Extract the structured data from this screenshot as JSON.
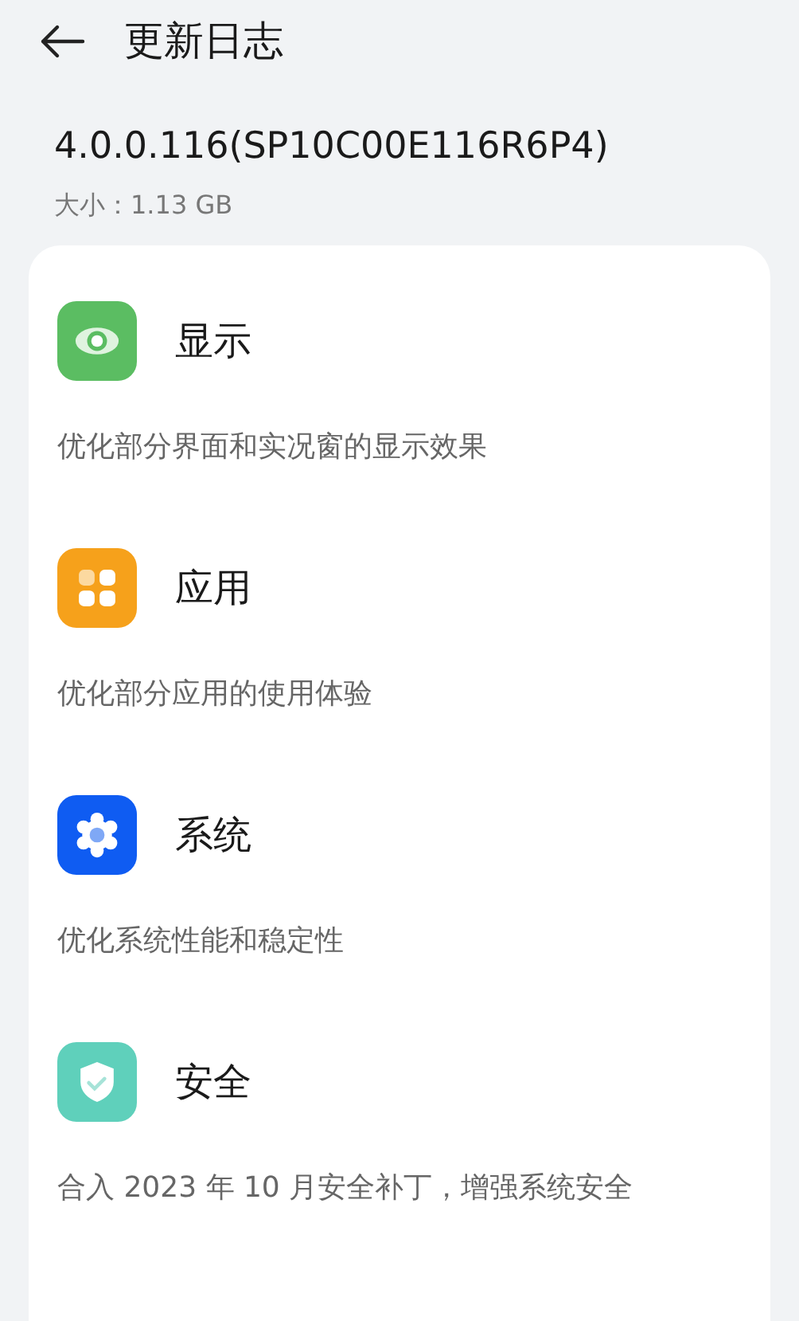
{
  "header": {
    "title": "更新日志"
  },
  "version": {
    "name": "4.0.0.116(SP10C00E116R6P4)",
    "size": "大小：1.13 GB"
  },
  "sections": [
    {
      "kind": "display",
      "title": "显示",
      "description": "优化部分界面和实况窗的显示效果"
    },
    {
      "kind": "apps",
      "title": "应用",
      "description": "优化部分应用的使用体验"
    },
    {
      "kind": "system",
      "title": "系统",
      "description": "优化系统性能和稳定性"
    },
    {
      "kind": "security",
      "title": "安全",
      "description": "合入 2023 年 10 月安全补丁，增强系统安全"
    }
  ]
}
